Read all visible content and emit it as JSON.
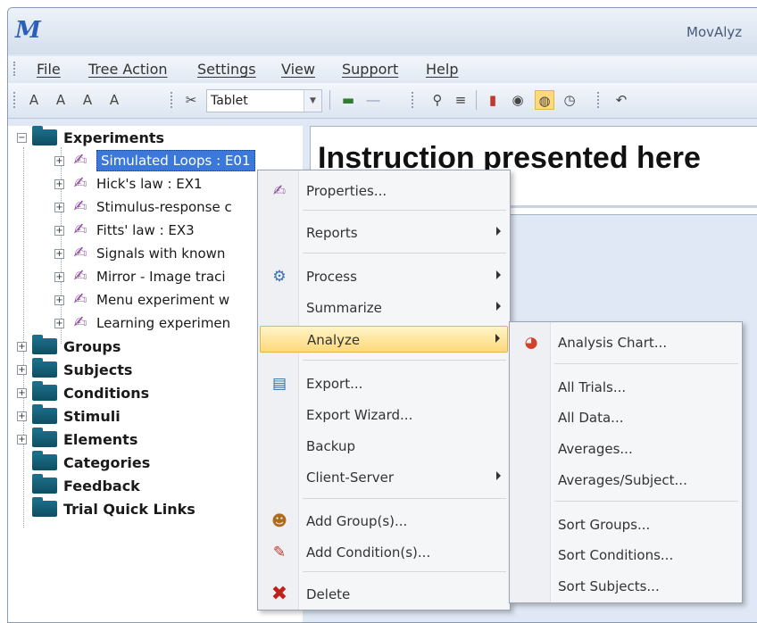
{
  "window": {
    "title": "MovAlyz",
    "logo": "M"
  },
  "menubar": [
    {
      "label": "File"
    },
    {
      "label": "Tree Action"
    },
    {
      "label": "Settings"
    },
    {
      "label": "View"
    },
    {
      "label": "Support"
    },
    {
      "label": "Help"
    }
  ],
  "toolbar": {
    "combo_value": "Tablet"
  },
  "tree": {
    "root": "Experiments",
    "experiments": [
      "Simulated Loops : E01",
      "Hick's law : EX1",
      "Stimulus-response c",
      "Fitts' law : EX3",
      "Signals with known",
      "Mirror - Image traci",
      "Menu experiment w",
      "Learning experimen"
    ],
    "folders": [
      "Groups",
      "Subjects",
      "Conditions",
      "Stimuli",
      "Elements",
      "Categories",
      "Feedback",
      "Trial Quick Links"
    ]
  },
  "content": {
    "instruction": "Instruction presented here"
  },
  "context_menu": {
    "items": [
      {
        "label": "Properties...",
        "icon": "pen-icon"
      },
      {
        "label": "Reports",
        "submenu": true
      },
      {
        "label": "Process",
        "icon": "gear-icon",
        "submenu": true
      },
      {
        "label": "Summarize",
        "submenu": true
      },
      {
        "label": "Analyze",
        "submenu": true,
        "highlighted": true
      },
      {
        "label": "Export...",
        "icon": "export-icon"
      },
      {
        "label": "Export Wizard..."
      },
      {
        "label": "Backup"
      },
      {
        "label": "Client-Server",
        "submenu": true
      },
      {
        "label": "Add Group(s)...",
        "icon": "people-icon"
      },
      {
        "label": "Add Condition(s)...",
        "icon": "pin-icon"
      },
      {
        "label": "Delete",
        "icon": "delete-icon"
      }
    ]
  },
  "analyze_submenu": {
    "items": [
      {
        "label": "Analysis Chart...",
        "icon": "chart-icon"
      },
      {
        "label": "All Trials..."
      },
      {
        "label": "All Data..."
      },
      {
        "label": "Averages..."
      },
      {
        "label": "Averages/Subject..."
      },
      {
        "label": "Sort Groups..."
      },
      {
        "label": "Sort Conditions..."
      },
      {
        "label": "Sort Subjects..."
      }
    ]
  },
  "colors": {
    "selection": "#3b78d9",
    "folder": "#1b6d88",
    "hover": "#ffd97a"
  }
}
